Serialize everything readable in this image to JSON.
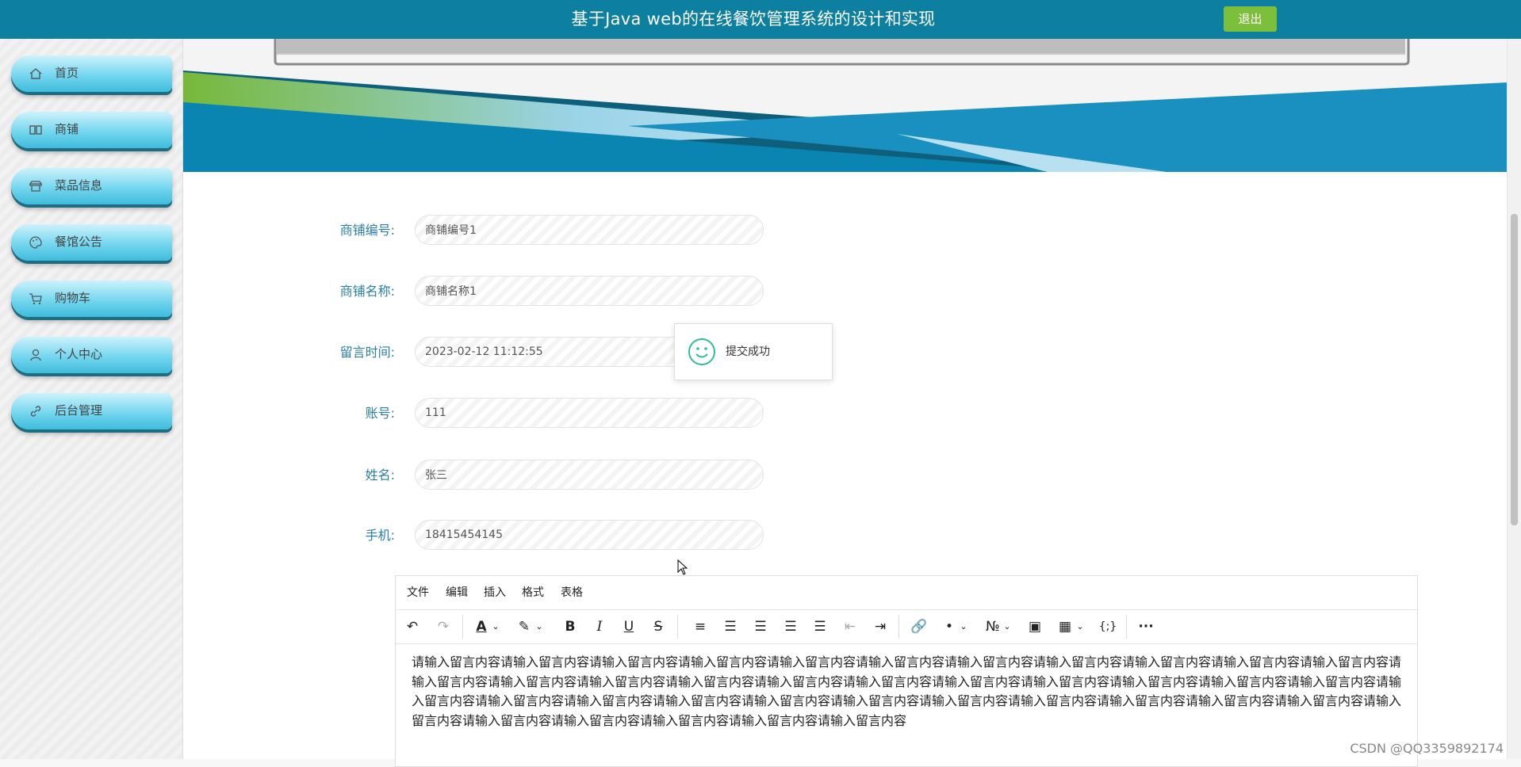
{
  "header": {
    "title": "基于Java web的在线餐饮管理系统的设计和实现",
    "logout_label": "退出"
  },
  "sidebar": {
    "items": [
      {
        "label": "首页",
        "icon": "home-icon"
      },
      {
        "label": "商铺",
        "icon": "book-icon"
      },
      {
        "label": "菜品信息",
        "icon": "shop-icon"
      },
      {
        "label": "餐馆公告",
        "icon": "palette-icon"
      },
      {
        "label": "购物车",
        "icon": "cart-icon"
      },
      {
        "label": "个人中心",
        "icon": "user-icon"
      },
      {
        "label": "后台管理",
        "icon": "link-icon"
      }
    ]
  },
  "form": {
    "fields": [
      {
        "label": "商铺编号:",
        "value": "商铺编号1"
      },
      {
        "label": "商铺名称:",
        "value": "商铺名称1"
      },
      {
        "label": "留言时间:",
        "value": "2023-02-12 11:12:55"
      },
      {
        "label": "账号:",
        "value": "111"
      },
      {
        "label": "姓名:",
        "value": "张三"
      },
      {
        "label": "手机:",
        "value": "18415454145"
      }
    ]
  },
  "toast": {
    "message": "提交成功",
    "icon": "smile-icon"
  },
  "editor": {
    "menu": [
      "文件",
      "编辑",
      "插入",
      "格式",
      "表格"
    ],
    "content": "请输入留言内容请输入留言内容请输入留言内容请输入留言内容请输入留言内容请输入留言内容请输入留言内容请输入留言内容请输入留言内容请输入留言内容请输入留言内容请输入留言内容请输入留言内容请输入留言内容请输入留言内容请输入留言内容请输入留言内容请输入留言内容请输入留言内容请输入留言内容请输入留言内容请输入留言内容请输入留言内容请输入留言内容请输入留言内容请输入留言内容请输入留言内容请输入留言内容请输入留言内容请输入留言内容请输入留言内容请输入留言内容请输入留言内容请输入留言内容请输入留言内容请输入留言内容请输入留言内容请输入留言内容请输入留言内容"
  },
  "watermark": "CSDN @QQ3359892174",
  "colors": {
    "header": "#0d7fa0",
    "accent": "#7cbf3a",
    "label": "#2a7fa6"
  }
}
